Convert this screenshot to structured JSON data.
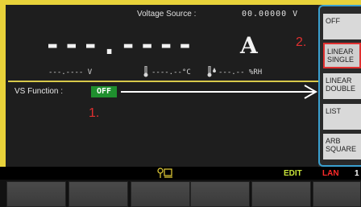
{
  "header": {
    "label": "Voltage Source :",
    "value": "00.00000  V"
  },
  "reading": {
    "main": "---.----",
    "unit": "A"
  },
  "status_row": {
    "voltage": "---.----  V",
    "temperature": "----.--°C",
    "humidity": "---.-- %RH"
  },
  "function": {
    "label": "VS Function :",
    "state": "OFF"
  },
  "annotations": {
    "step1": "1.",
    "step2": "2."
  },
  "soft_keys": [
    {
      "label": "OFF"
    },
    {
      "label": "LINEAR SINGLE"
    },
    {
      "label": "LINEAR DOUBLE"
    },
    {
      "label": "LIST"
    },
    {
      "label": "ARB SQUARE"
    }
  ],
  "status_bar": {
    "edit": "EDIT",
    "lan": "LAN",
    "channel": "1"
  },
  "colors": {
    "accent_yellow": "#e8d23a",
    "panel_border": "#3aa0d0",
    "highlight_red": "#e03030",
    "off_green": "#1f8f2e"
  }
}
